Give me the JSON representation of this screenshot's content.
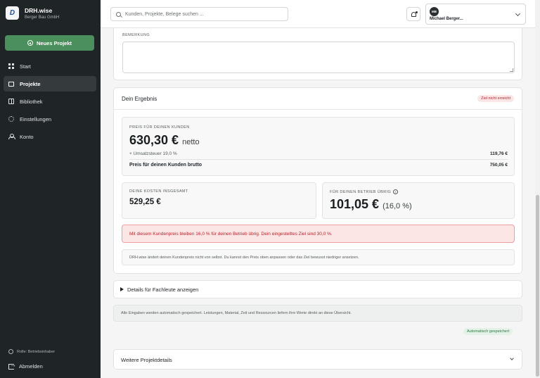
{
  "sidebar": {
    "logo_text": "D",
    "brand_name": "DRH.wise",
    "brand_sub": "Berger Bau GmbH",
    "new_project_label": "Neues Projekt",
    "items": [
      {
        "label": "Start",
        "icon": "grid-icon"
      },
      {
        "label": "Projekte",
        "icon": "folder-icon",
        "active": true
      },
      {
        "label": "Bibliothek",
        "icon": "book-icon"
      },
      {
        "label": "Einstellungen",
        "icon": "gear-icon"
      },
      {
        "label": "Konto",
        "icon": "user-icon"
      }
    ],
    "role": "Rolle: Betriebsinhaber",
    "logout": "Abmelden"
  },
  "header": {
    "search_placeholder": "Kunden, Projekte, Belege suchen ...",
    "user_initials": "MB",
    "user_name": "Michael Berger..."
  },
  "remark": {
    "label": "BEMERKUNG",
    "value": ""
  },
  "result": {
    "title": "Dein Ergebnis",
    "status_badge": "Ziel nicht erreicht",
    "price_label": "PREIS FÜR DEINEN KUNDEN",
    "price_value": "630,30 €",
    "price_suffix": "netto",
    "vat_label": "+ Umsatzsteuer 19,0 %",
    "vat_value": "119,76 €",
    "gross_label": "Preis für deinen Kunden brutto",
    "gross_value": "750,05 €",
    "cost_label": "DEINE KOSTEN INSGESAMT",
    "cost_value": "529,25 €",
    "remaining_label": "FÜR DEINEN BETRIEB ÜBRIG",
    "remaining_value": "101,05 €",
    "remaining_pct": "(16,0 %)",
    "alert_text": "Mit diesem Kundenpreis bleiben 16,0 % für deinen Betrieb übrig. Dein eingestelltes Ziel sind 30,0 %.",
    "note_text": "DRH.wise ändert deinen Kundenpreis nicht von selbst. Du kannst den Preis oben anpassen oder das Ziel bewusst niedriger ansetzen."
  },
  "details_toggle": "Details für Fachleute anzeigen",
  "autosave_note": "Alle Eingaben werden automatisch gespeichert. Leistungen, Material, Zeit und Ressourcen liefern ihre Werte direkt an diese Übersicht.",
  "autosave_badge": "Automatisch gespeichert",
  "more_details": "Weitere Projektdetails",
  "colors": {
    "sidebar_bg": "#1f2426",
    "accent_green": "#4b8f5c",
    "alert_red": "#b3262d"
  }
}
